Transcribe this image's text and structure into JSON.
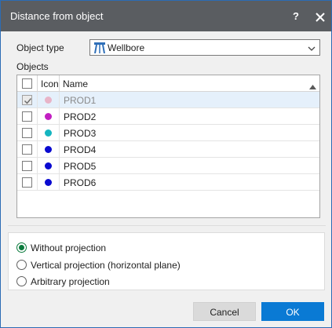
{
  "window": {
    "title": "Distance from object",
    "help_glyph": "?",
    "close_icon": "close-icon"
  },
  "object_type": {
    "label": "Object type",
    "selected": "Wellbore",
    "icon": "wellbore-icon"
  },
  "objects": {
    "label": "Objects",
    "columns": [
      "",
      "Icon",
      "Name"
    ],
    "sort": "ascending",
    "rows": [
      {
        "name": "PROD1",
        "checked": true,
        "selected": true,
        "color": "#e8b4c8"
      },
      {
        "name": "PROD2",
        "checked": false,
        "selected": false,
        "color": "#c21fc2"
      },
      {
        "name": "PROD3",
        "checked": false,
        "selected": false,
        "color": "#15b5c0"
      },
      {
        "name": "PROD4",
        "checked": false,
        "selected": false,
        "color": "#0a0ad0"
      },
      {
        "name": "PROD5",
        "checked": false,
        "selected": false,
        "color": "#0a0ad0"
      },
      {
        "name": "PROD6",
        "checked": false,
        "selected": false,
        "color": "#0a0ad0"
      }
    ]
  },
  "projection": {
    "options": [
      {
        "label": "Without projection",
        "selected": true
      },
      {
        "label": "Vertical projection (horizontal plane)",
        "selected": false
      },
      {
        "label": "Arbitrary projection",
        "selected": false
      }
    ]
  },
  "buttons": {
    "cancel": "Cancel",
    "ok": "OK"
  },
  "colors": {
    "titlebar": "#5a5d61",
    "accent": "#0a7ad4",
    "radio_selected": "#0a7a3c"
  }
}
